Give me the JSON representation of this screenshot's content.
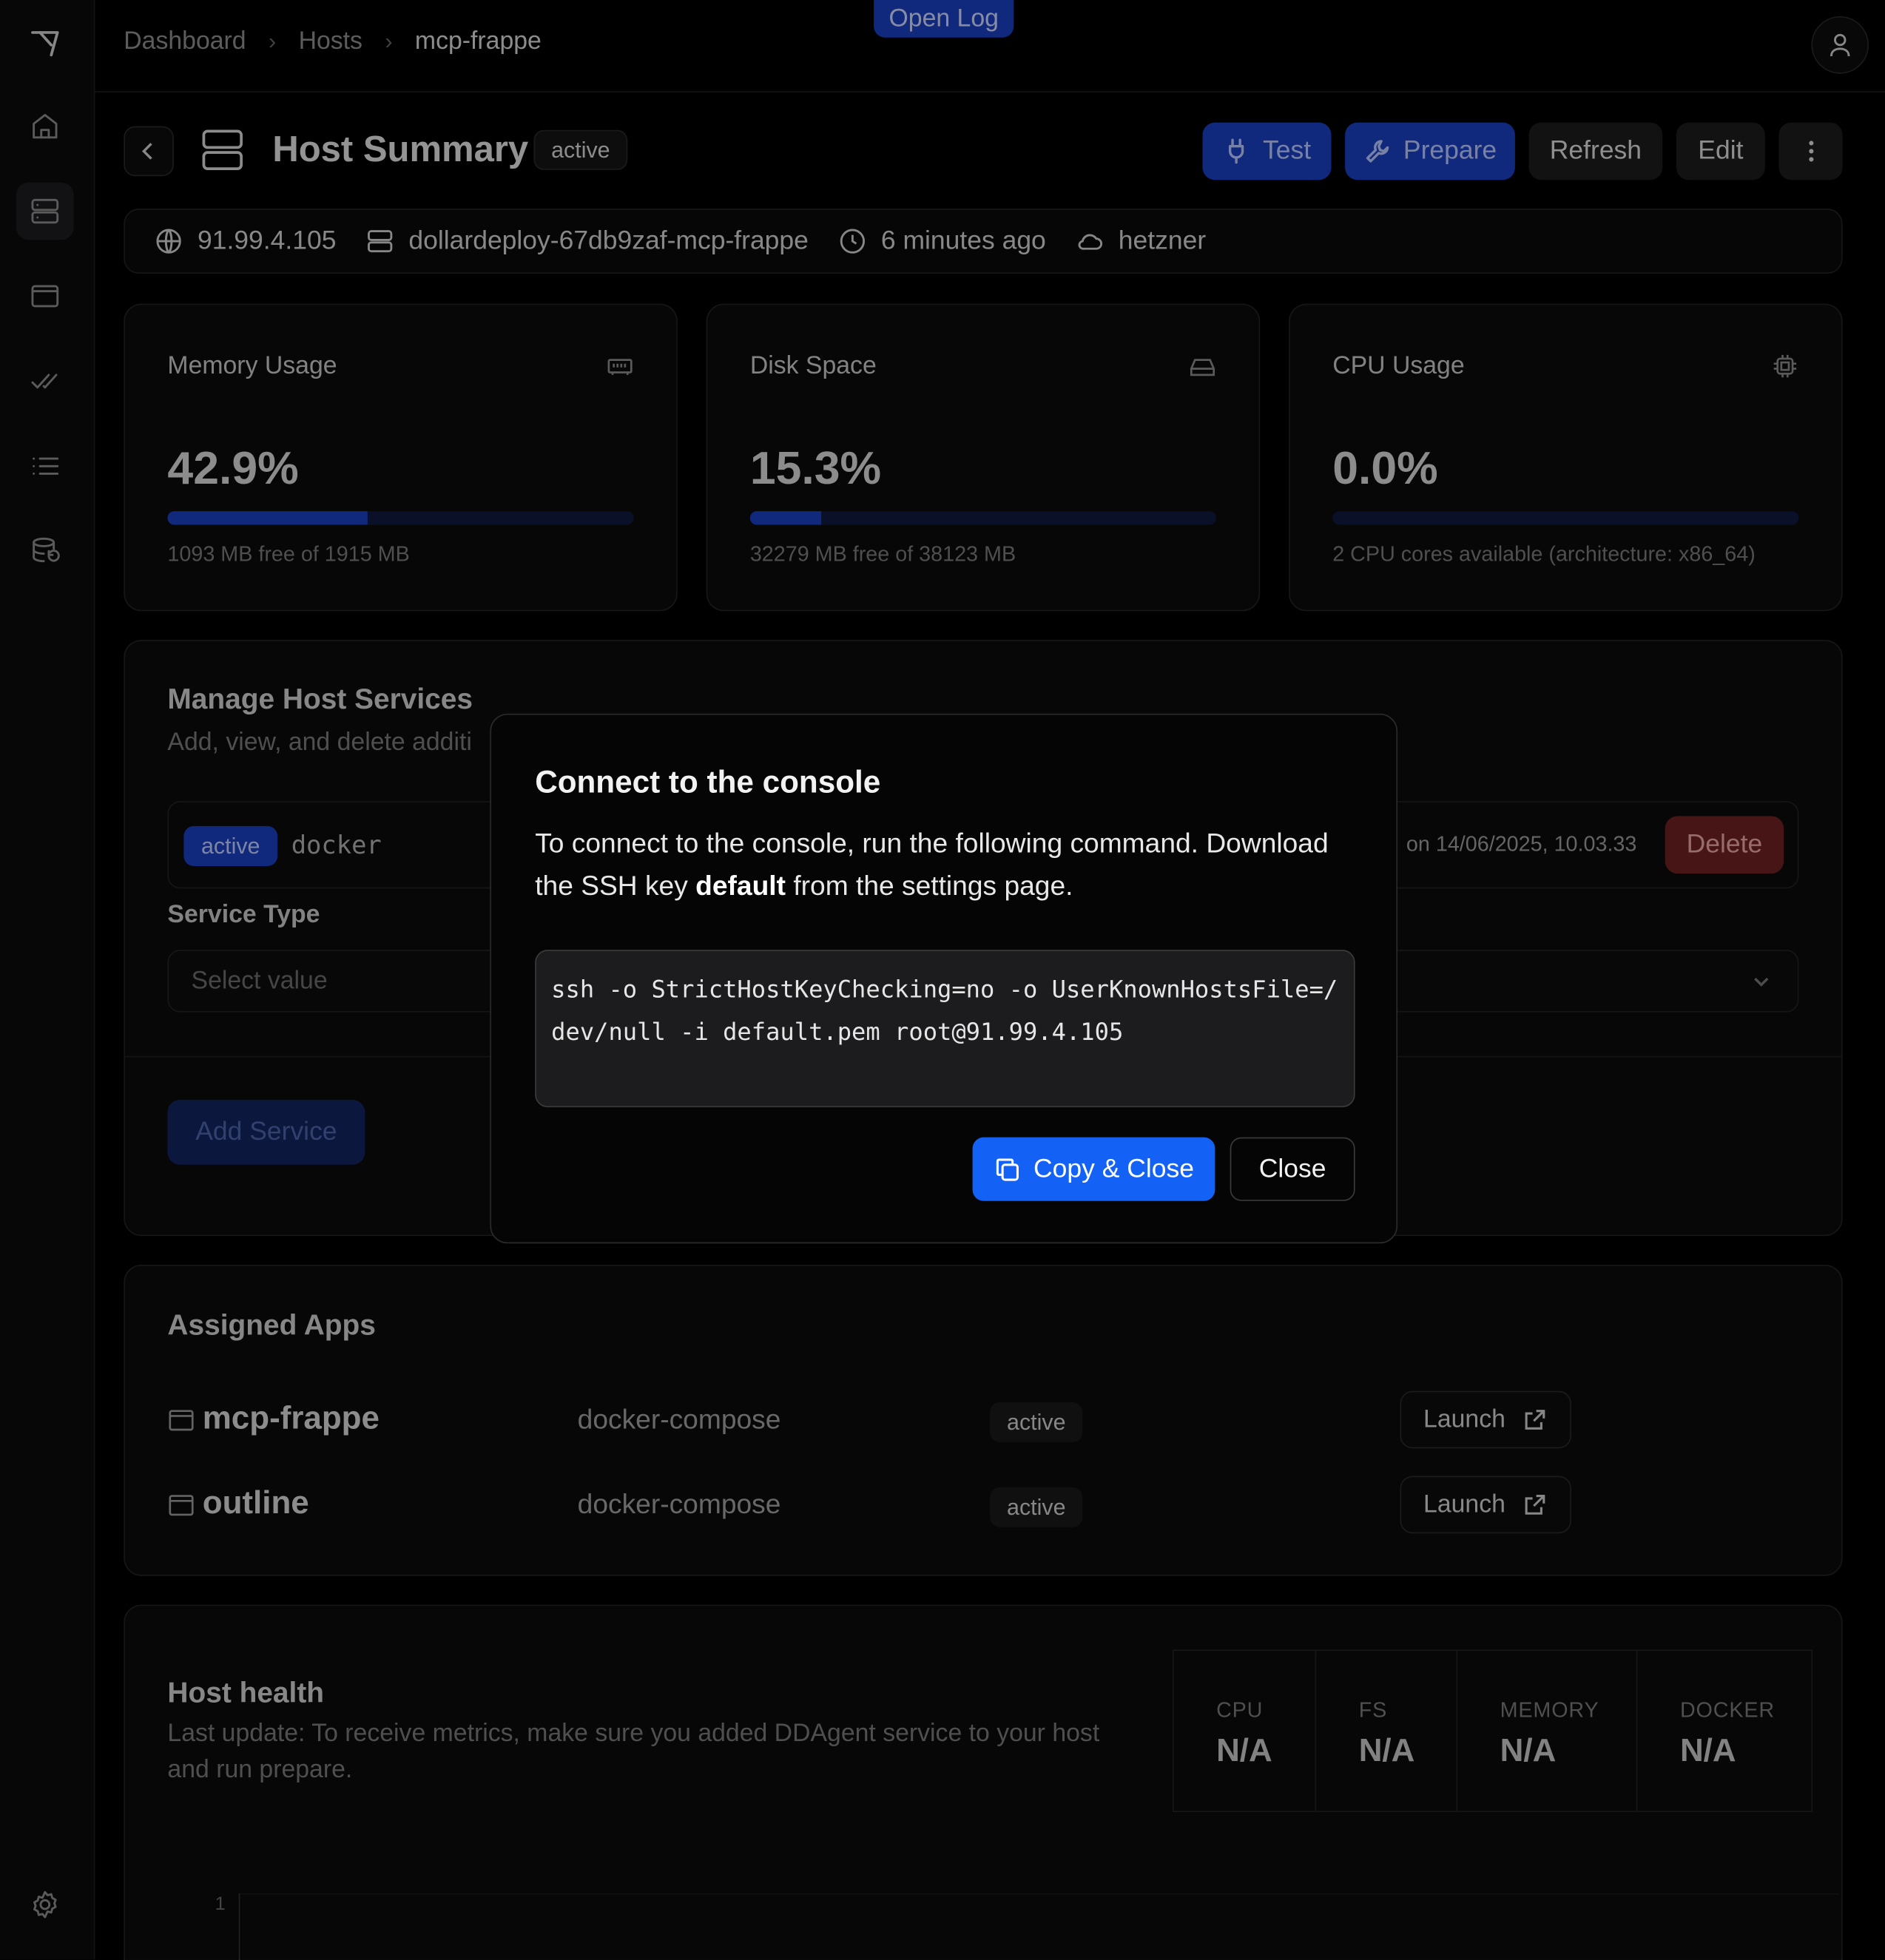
{
  "topbar": {
    "breadcrumbs": [
      "Dashboard",
      "Hosts",
      "mcp-frappe"
    ],
    "open_log_label": "Open Log"
  },
  "header": {
    "title": "Host Summary",
    "status_badge": "active",
    "buttons": {
      "test": "Test",
      "prepare": "Prepare",
      "refresh": "Refresh",
      "edit": "Edit"
    }
  },
  "meta": {
    "ip": "91.99.4.105",
    "hostname": "dollardeploy-67db9zaf-mcp-frappe",
    "updated": "6 minutes ago",
    "provider": "hetzner"
  },
  "stats": [
    {
      "label": "Memory Usage",
      "value": "42.9%",
      "percent": 42.9,
      "sub": "1093 MB free of 1915 MB",
      "icon": "memory-icon"
    },
    {
      "label": "Disk Space",
      "value": "15.3%",
      "percent": 15.3,
      "sub": "32279 MB free of 38123 MB",
      "icon": "hard-drive-icon"
    },
    {
      "label": "CPU Usage",
      "value": "0.0%",
      "percent": 0.0,
      "sub": "2 CPU cores available (architecture: x86_64)",
      "icon": "cpu-icon"
    }
  ],
  "services": {
    "title": "Manage Host Services",
    "subtitle": "Add, view, and delete additi",
    "row": {
      "status": "active",
      "name": "docker",
      "date_fragment": "on 14/06/2025, 10.03.33",
      "delete_label": "Delete"
    },
    "service_type_label": "Service Type",
    "select_placeholder": "Select value",
    "add_label": "Add Service"
  },
  "apps": {
    "title": "Assigned Apps",
    "rows": [
      {
        "name": "mcp-frappe",
        "type": "docker-compose",
        "status": "active",
        "launch": "Launch"
      },
      {
        "name": "outline",
        "type": "docker-compose",
        "status": "active",
        "launch": "Launch"
      }
    ]
  },
  "health": {
    "title": "Host health",
    "subtitle": "Last update: To receive metrics, make sure you added DDAgent service to your host and run prepare.",
    "metrics": [
      {
        "label": "CPU",
        "value": "N/A"
      },
      {
        "label": "FS",
        "value": "N/A"
      },
      {
        "label": "MEMORY",
        "value": "N/A"
      },
      {
        "label": "DOCKER",
        "value": "N/A"
      }
    ],
    "axis_tick": "1"
  },
  "modal": {
    "title": "Connect to the console",
    "desc_before": "To connect to the console, run the following command. Download the SSH key ",
    "desc_key": "default",
    "desc_after": " from the settings page.",
    "command": "ssh -o StrictHostKeyChecking=no -o UserKnownHostsFile=/dev/null -i default.pem root@91.99.4.105",
    "copy_label": "Copy & Close",
    "close_label": "Close"
  },
  "colors": {
    "accent": "#1b3fc0",
    "primary_button": "#1462f5",
    "danger": "#6e2121"
  }
}
